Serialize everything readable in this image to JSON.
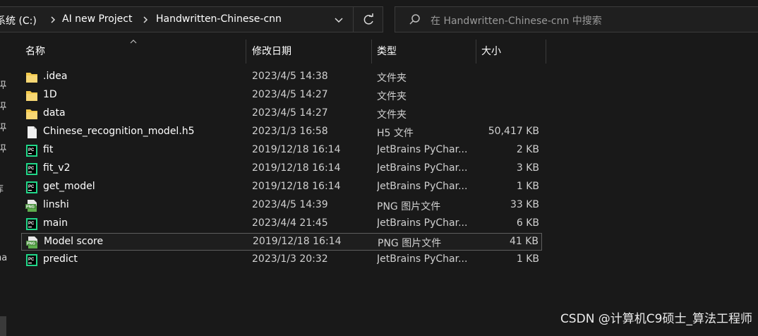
{
  "breadcrumb": {
    "items": [
      "系统 (C:)",
      "AI new Project",
      "Handwritten-Chinese-cnn"
    ]
  },
  "search": {
    "placeholder": "在 Handwritten-Chinese-cnn 中搜索"
  },
  "nav_fragments": [
    "库",
    "na"
  ],
  "columns": {
    "name": "名称",
    "date": "修改日期",
    "type": "类型",
    "size": "大小"
  },
  "files": [
    {
      "name": ".idea",
      "date": "2023/4/5 14:38",
      "type": "文件夹",
      "size": "",
      "icon": "folder-icon"
    },
    {
      "name": "1D",
      "date": "2023/4/5 14:27",
      "type": "文件夹",
      "size": "",
      "icon": "folder-icon"
    },
    {
      "name": "data",
      "date": "2023/4/5 14:27",
      "type": "文件夹",
      "size": "",
      "icon": "folder-icon"
    },
    {
      "name": "Chinese_recognition_model.h5",
      "date": "2023/1/3 16:58",
      "type": "H5 文件",
      "size": "50,417 KB",
      "icon": "file-icon"
    },
    {
      "name": "fit",
      "date": "2019/12/18 16:14",
      "type": "JetBrains PyChar...",
      "size": "2 KB",
      "icon": "pycharm-file-icon"
    },
    {
      "name": "fit_v2",
      "date": "2019/12/18 16:14",
      "type": "JetBrains PyChar...",
      "size": "3 KB",
      "icon": "pycharm-file-icon"
    },
    {
      "name": "get_model",
      "date": "2019/12/18 16:14",
      "type": "JetBrains PyChar...",
      "size": "1 KB",
      "icon": "pycharm-file-icon"
    },
    {
      "name": "linshi",
      "date": "2023/4/5 14:39",
      "type": "PNG 图片文件",
      "size": "33 KB",
      "icon": "png-file-icon"
    },
    {
      "name": "main",
      "date": "2023/4/4 21:45",
      "type": "JetBrains PyChar...",
      "size": "6 KB",
      "icon": "pycharm-file-icon"
    },
    {
      "name": "Model score",
      "date": "2019/12/18 16:14",
      "type": "PNG 图片文件",
      "size": "41 KB",
      "icon": "png-file-icon",
      "selected": true
    },
    {
      "name": "predict",
      "date": "2023/1/3 20:32",
      "type": "JetBrains PyChar...",
      "size": "1 KB",
      "icon": "pycharm-file-icon"
    }
  ],
  "watermark": "CSDN @计算机C9硕士_算法工程师",
  "colors": {
    "background": "#191919",
    "folder": "#f2c94c",
    "pycharm_green": "#21d789",
    "border": "#3b3b3b"
  }
}
